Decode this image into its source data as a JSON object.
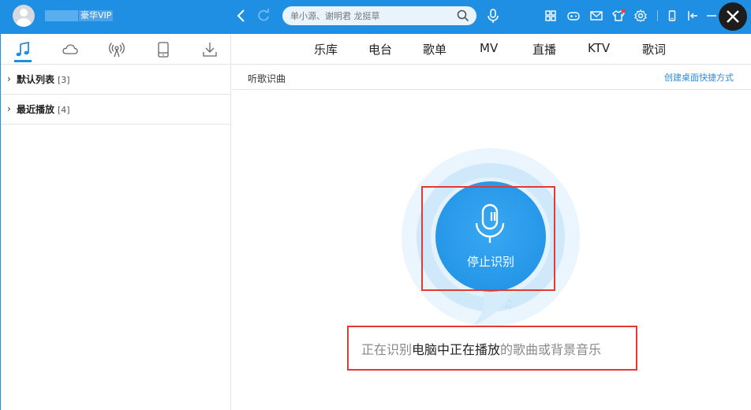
{
  "header": {
    "vip_label": "豪华VIP",
    "search_placeholder": "单小源、谢明君 龙挺草",
    "icons": [
      "back-icon",
      "refresh-icon",
      "search-icon",
      "mic-icon",
      "grid-icon",
      "gamepad-icon",
      "mail-icon",
      "shirt-icon",
      "gear-icon",
      "phone-icon",
      "mini-mode-icon",
      "minimize-icon",
      "close-icon"
    ]
  },
  "left_tabs": [
    "music-note-icon",
    "cloud-icon",
    "radio-icon",
    "device-icon",
    "download-icon"
  ],
  "playlists": [
    {
      "name": "默认列表",
      "count": "[3]"
    },
    {
      "name": "最近播放",
      "count": "[4]"
    }
  ],
  "main_nav": [
    "乐库",
    "电台",
    "歌单",
    "MV",
    "直播",
    "KTV",
    "歌词"
  ],
  "subheader": {
    "title": "听歌识曲",
    "shortcut": "创建桌面快捷方式"
  },
  "recognition": {
    "button_label": "停止识别",
    "status_prefix": "正在识别",
    "status_highlight": "电脑中正在播放",
    "status_suffix": "的歌曲或背景音乐"
  },
  "colors": {
    "accent": "#1e8fe3",
    "highlight_box": "#e23a34"
  }
}
